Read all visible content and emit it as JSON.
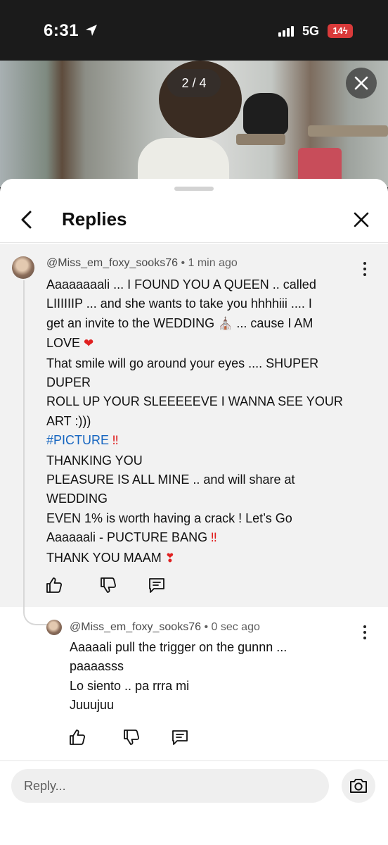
{
  "status_bar": {
    "time": "6:31",
    "network": "5G",
    "battery": "14"
  },
  "video": {
    "counter": "2 / 4"
  },
  "sheet": {
    "title": "Replies"
  },
  "comment": {
    "handle": "@Miss_em_foxy_sooks76",
    "time": "• 1 min ago",
    "lines": [
      "Aaaaaaaali ... I FOUND YOU A QUEEN .. called",
      "LIIIIIIP ... and she wants to take you hhhhiii .... I",
      "get an invite to the WEDDING",
      "... cause I AM",
      "LOVE",
      "That smile will go around your eyes .... SHUPER",
      "DUPER",
      "ROLL UP YOUR SLEEEEEVE I WANNA SEE YOUR",
      "ART :)))",
      "#PICTURE",
      "THANKING YOU",
      "PLEASURE IS ALL MINE .. and will share at",
      "WEDDING",
      "EVEN 1% is worth having a crack ! Let’s Go",
      "Aaaaaali - PUCTURE BANG",
      "THANK YOU MAAM"
    ]
  },
  "reply": {
    "handle": "@Miss_em_foxy_sooks76",
    "time": "• 0 sec ago",
    "lines": [
      "Aaaaali pull the trigger on the gunnn ...",
      "paaaasss",
      "Lo siento  .. pa rrra mi",
      "Juuujuu"
    ]
  },
  "input": {
    "placeholder": "Reply..."
  },
  "colors": {
    "hashtag": "#1565c0",
    "accent_red": "#e02020",
    "battery": "#d93a3a"
  },
  "icons": [
    "location-arrow-icon",
    "signal-icon",
    "close-icon",
    "back-arrow-icon",
    "more-vert-icon",
    "thumbs-up-icon",
    "thumbs-down-icon",
    "comment-icon",
    "camera-icon",
    "wedding-chapel-icon",
    "heart-icon",
    "double-exclamation-icon",
    "heart-exclamation-icon"
  ]
}
